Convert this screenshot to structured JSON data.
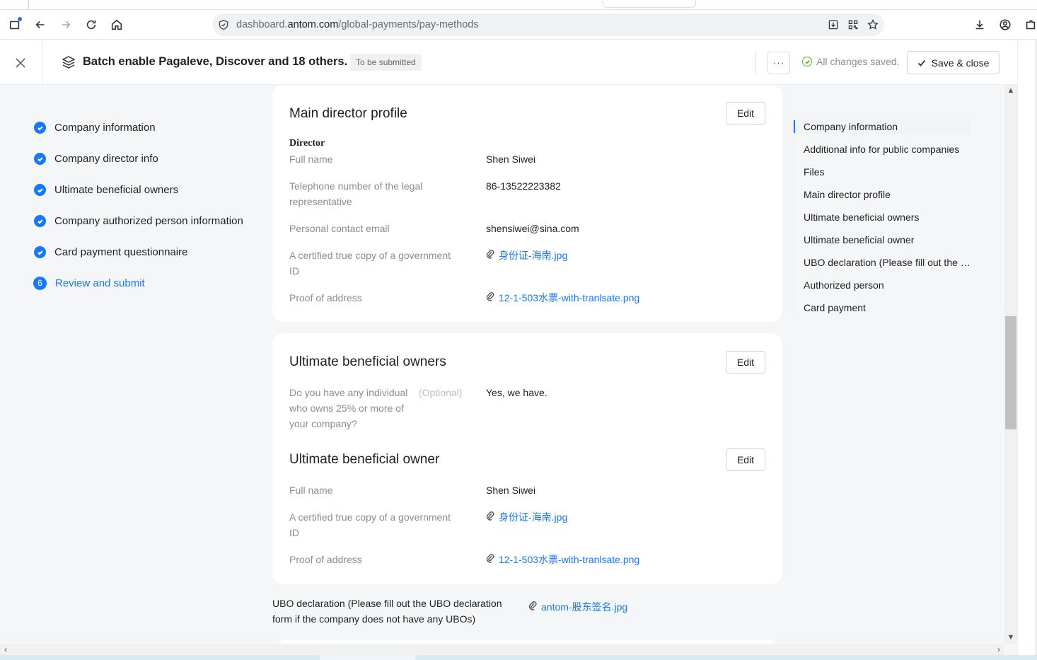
{
  "browser": {
    "url_prefix": "dashboard.",
    "url_domain": "antom.com",
    "url_path": "/global-payments/pay-methods"
  },
  "header": {
    "title": "Batch enable Pagaleve, Discover and 18 others.",
    "status": "To be submitted",
    "more": "···",
    "saved_text": "All changes saved.",
    "save_close": "Save & close"
  },
  "steps": [
    {
      "label": "Company information"
    },
    {
      "label": "Company director info"
    },
    {
      "label": "Ultimate beneficial owners"
    },
    {
      "label": "Company authorized person information"
    },
    {
      "label": "Card payment questionnaire"
    },
    {
      "label": "Review and submit",
      "number": "6"
    }
  ],
  "director_card": {
    "title": "Main director profile",
    "edit": "Edit",
    "subhead": "Director",
    "fields": [
      {
        "label": "Full name",
        "value": "Shen Siwei"
      },
      {
        "label": "Telephone number of the legal representative",
        "value": "86-13522223382"
      },
      {
        "label": "Personal contact email",
        "value": "shensiwei@sina.com"
      },
      {
        "label": "A certified true copy of a government ID",
        "value": "身份证-海南.jpg"
      },
      {
        "label": "Proof of address",
        "value": "12-1-503水票-with-tranlsate.png"
      }
    ]
  },
  "ubo_card": {
    "title": "Ultimate beneficial owners",
    "edit": "Edit",
    "question": "Do you have any individual who owns 25% or more of your company?",
    "optional": "(Optional)",
    "answer": "Yes, we have.",
    "owner_title": "Ultimate beneficial owner",
    "owner_edit": "Edit",
    "owner_fields": [
      {
        "label": "Full name",
        "value": "Shen Siwei"
      },
      {
        "label": "A certified true copy of a government ID",
        "value": "身份证-海南.jpg"
      },
      {
        "label": "Proof of address",
        "value": "12-1-503水票-with-tranlsate.png"
      }
    ]
  },
  "ubo_declaration": {
    "label": "UBO declaration (Please fill out the UBO declaration form if the company does not have any UBOs)",
    "file": "antom-股东签名.jpg"
  },
  "anchors": [
    "Company information",
    "Additional info for public companies",
    "Files",
    "Main director profile",
    "Ultimate beneficial owners",
    "Ultimate beneficial owner",
    "UBO declaration (Please fill out the UBO declaration form if the company does not have any UBOs)",
    "Authorized person",
    "Card payment"
  ],
  "colors": {
    "accent": "#1677ff",
    "success": "#52c41a",
    "page_bg": "#f5f6f8"
  }
}
